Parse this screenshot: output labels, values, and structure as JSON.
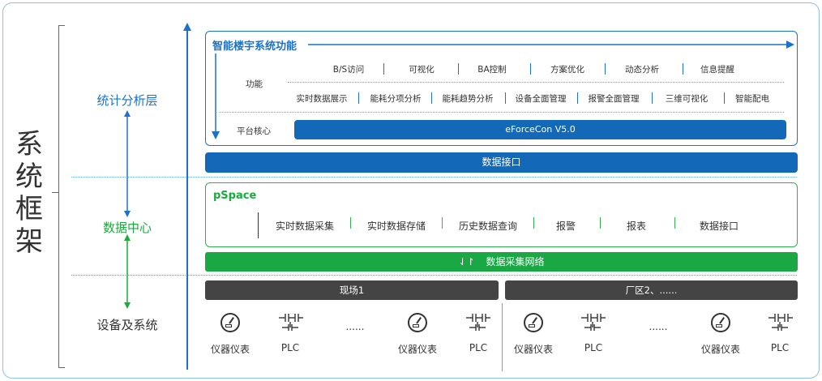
{
  "system": {
    "title_chars": [
      "系",
      "统",
      "框",
      "架"
    ]
  },
  "layers": {
    "analysis": "统计分析层",
    "data_center": "数据中心",
    "devices": "设备及系统"
  },
  "building": {
    "title": "智能楼宇系统功能",
    "function_label": "功能",
    "row1": [
      "B/S访问",
      "可视化",
      "BA控制",
      "方案优化",
      "动态分析",
      "信息提醒"
    ],
    "row2": [
      "实时数据展示",
      "能耗分项分析",
      "能耗趋势分析",
      "设备全面管理",
      "报警全面管理",
      "三维可视化",
      "智能配电"
    ],
    "core_label": "平台核心",
    "core_value": "eForceCon V5.0"
  },
  "data_interface": "数据接口",
  "pspace": {
    "title": "pSpace",
    "items": [
      "实时数据采集",
      "实时数据存储",
      "历史数据查询",
      "报警",
      "报表",
      "数据接口"
    ]
  },
  "network": {
    "icon": "⇃↾",
    "label": "数据采集网络"
  },
  "sites": {
    "site1": "现场1",
    "site2": "厂区2、......"
  },
  "devices": {
    "instrument": "仪器仪表",
    "plc": "PLC",
    "ellipsis": "......"
  },
  "colors": {
    "blue": "#1a73c8",
    "green": "#1aab3e",
    "dark": "#444444"
  }
}
